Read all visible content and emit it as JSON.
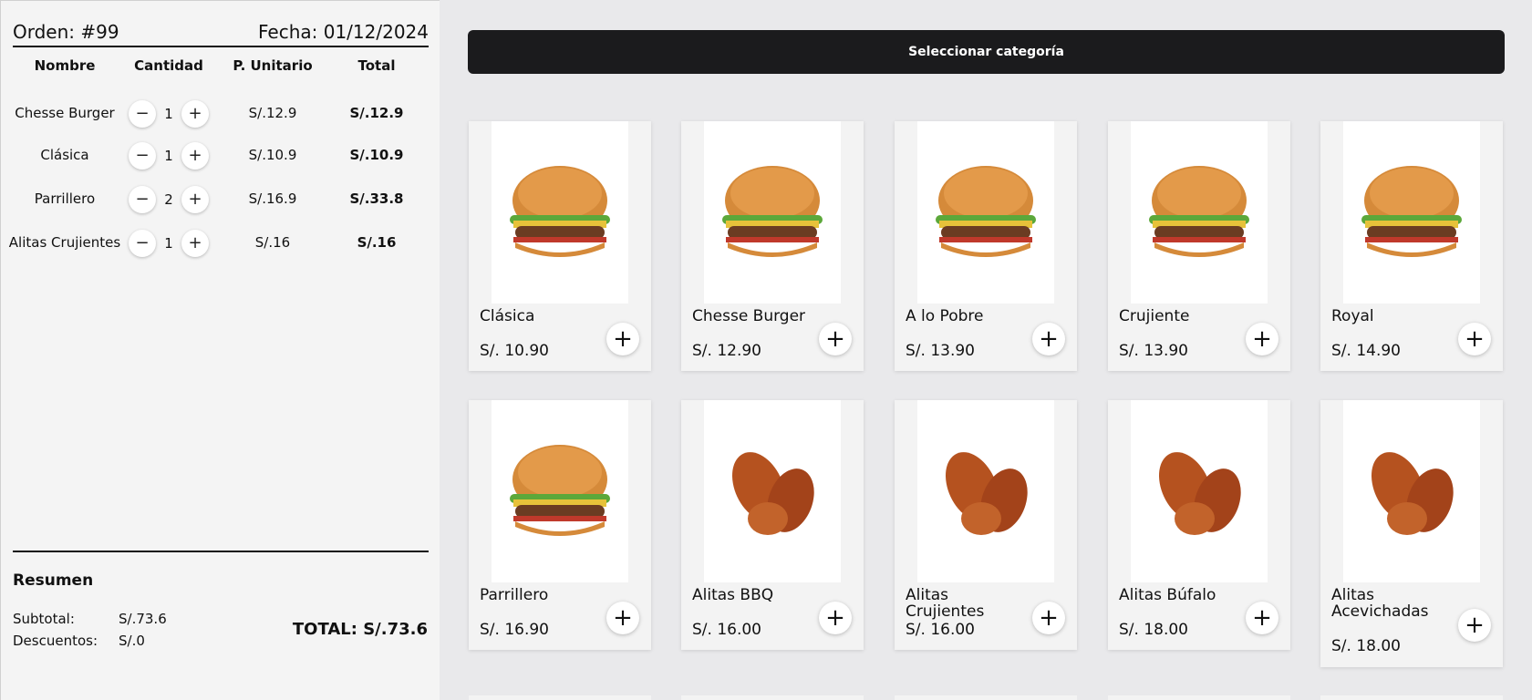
{
  "order": {
    "number_label": "Orden: #99",
    "date_label": "Fecha: 01/12/2024",
    "columns": [
      "Nombre",
      "Cantidad",
      "P. Unitario",
      "Total"
    ],
    "items": [
      {
        "name": "Chesse Burger",
        "qty": "1",
        "unit": "S/.12.9",
        "total": "S/.12.9"
      },
      {
        "name": "Clásica",
        "qty": "1",
        "unit": "S/.10.9",
        "total": "S/.10.9"
      },
      {
        "name": "Parrillero",
        "qty": "2",
        "unit": "S/.16.9",
        "total": "S/.33.8"
      },
      {
        "name": "Alitas Crujientes",
        "qty": "1",
        "unit": "S/.16",
        "total": "S/.16"
      }
    ],
    "minus_glyph": "−",
    "plus_glyph": "+",
    "summary": {
      "title": "Resumen",
      "subtotal_label": "Subtotal:",
      "subtotal_value": "S/.73.6",
      "discount_label": "Descuentos:",
      "discount_value": "S/.0",
      "total": "TOTAL: S/.73.6"
    }
  },
  "catalog": {
    "category_button": "Seleccionar categoría",
    "add_glyph": "+",
    "products": [
      {
        "name": "Clásica",
        "price": "S/. 10.90",
        "icon": "burger-icon"
      },
      {
        "name": "Chesse Burger",
        "price": "S/. 12.90",
        "icon": "burger-icon"
      },
      {
        "name": "A lo Pobre",
        "price": "S/. 13.90",
        "icon": "burger-icon"
      },
      {
        "name": "Crujiente",
        "price": "S/. 13.90",
        "icon": "burger-icon"
      },
      {
        "name": "Royal",
        "price": "S/. 14.90",
        "icon": "burger-icon"
      },
      {
        "name": "Parrillero",
        "price": "S/. 16.90",
        "icon": "burger-icon"
      },
      {
        "name": "Alitas BBQ",
        "price": "S/. 16.00",
        "icon": "chicken-wings-icon"
      },
      {
        "name": "Alitas Crujientes",
        "price": "S/. 16.00",
        "icon": "chicken-wings-icon"
      },
      {
        "name": "Alitas Búfalo",
        "price": "S/. 18.00",
        "icon": "chicken-wings-icon"
      },
      {
        "name": "Alitas Acevichadas",
        "price": "S/. 18.00",
        "icon": "chicken-wings-icon"
      }
    ]
  }
}
